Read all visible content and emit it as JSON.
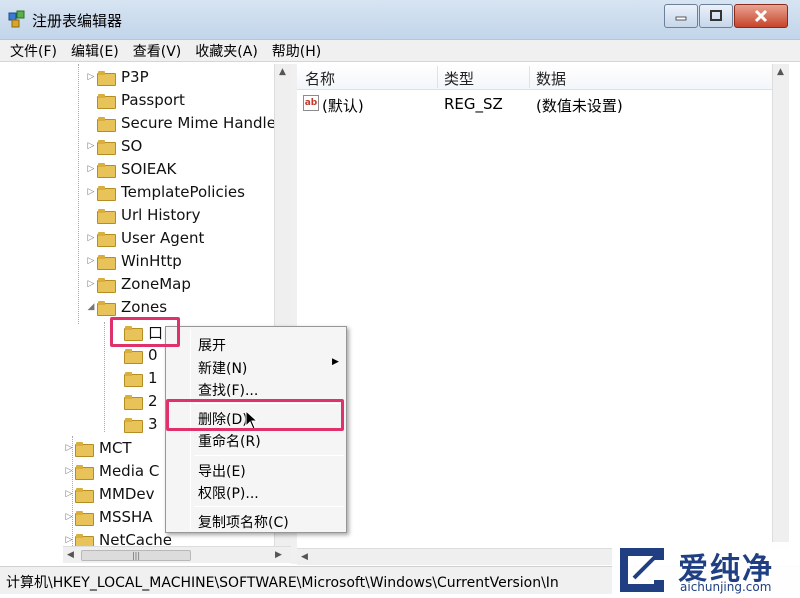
{
  "window": {
    "title": "注册表编辑器"
  },
  "menu": [
    "文件(F)",
    "编辑(E)",
    "查看(V)",
    "收藏夹(A)",
    "帮助(H)"
  ],
  "tree": {
    "items": [
      {
        "label": "P3P",
        "expanded": false,
        "level": 1
      },
      {
        "label": "Passport",
        "expanded": false,
        "level": 1
      },
      {
        "label": "Secure Mime Handle",
        "expanded": false,
        "level": 1
      },
      {
        "label": "SO",
        "expanded": false,
        "level": 1
      },
      {
        "label": "SOIEAK",
        "expanded": false,
        "level": 1
      },
      {
        "label": "TemplatePolicies",
        "expanded": false,
        "level": 1
      },
      {
        "label": "Url History",
        "expanded": false,
        "level": 1
      },
      {
        "label": "User Agent",
        "expanded": false,
        "level": 1
      },
      {
        "label": "WinHttp",
        "expanded": false,
        "level": 1
      },
      {
        "label": "ZoneMap",
        "expanded": false,
        "level": 1
      },
      {
        "label": "Zones",
        "expanded": true,
        "level": 1
      },
      {
        "label": "口",
        "expanded": false,
        "level": 2
      },
      {
        "label": "0",
        "expanded": false,
        "level": 2
      },
      {
        "label": "1",
        "expanded": false,
        "level": 2
      },
      {
        "label": "2",
        "expanded": false,
        "level": 2
      },
      {
        "label": "3",
        "expanded": false,
        "level": 2
      },
      {
        "label": "MCT",
        "expanded": false,
        "level": 0
      },
      {
        "label": "Media C",
        "expanded": false,
        "level": 0
      },
      {
        "label": "MMDev",
        "expanded": false,
        "level": 0
      },
      {
        "label": "MSSHA",
        "expanded": false,
        "level": 0
      },
      {
        "label": "NetCache",
        "expanded": false,
        "level": 0
      }
    ]
  },
  "list": {
    "columns": [
      "名称",
      "类型",
      "数据"
    ],
    "rows": [
      {
        "name": "(默认)",
        "type": "REG_SZ",
        "data": "(数值未设置)"
      }
    ]
  },
  "context_menu": {
    "items": [
      "展开",
      "新建(N)",
      "查找(F)...",
      "删除(D)",
      "重命名(R)",
      "导出(E)",
      "权限(P)...",
      "复制项名称(C)"
    ],
    "highlighted": "删除(D)"
  },
  "status": {
    "path": "计算机\\HKEY_LOCAL_MACHINE\\SOFTWARE\\Microsoft\\Windows\\CurrentVersion\\In"
  },
  "watermark": {
    "cn": "爱纯净",
    "en": "aichunjing.com"
  },
  "colors": {
    "highlight_box": "#e0326a",
    "folder": "#e8c35a",
    "watermark": "#1f3f82"
  }
}
